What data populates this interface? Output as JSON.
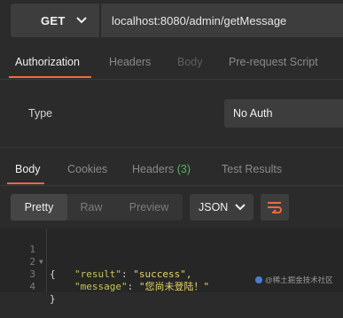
{
  "request": {
    "method": "GET",
    "url": "localhost:8080/admin/getMessage"
  },
  "request_tabs": [
    {
      "label": "Authorization",
      "active": true
    },
    {
      "label": "Headers",
      "active": false
    },
    {
      "label": "Body",
      "active": false
    },
    {
      "label": "Pre-request Script",
      "active": false
    }
  ],
  "auth": {
    "type_label": "Type",
    "type_value": "No Auth"
  },
  "response_tabs": [
    {
      "label": "Body",
      "active": true
    },
    {
      "label": "Cookies",
      "active": false
    },
    {
      "label": "Headers",
      "count": "(3)",
      "active": false
    },
    {
      "label": "Test Results",
      "active": false
    }
  ],
  "format_buttons": [
    {
      "label": "Pretty",
      "active": true
    },
    {
      "label": "Raw",
      "active": false
    },
    {
      "label": "Preview",
      "active": false
    }
  ],
  "format_select": "JSON",
  "code_lines": [
    {
      "num": "1",
      "text": "{"
    },
    {
      "num": "2",
      "key": "\"result\"",
      "value": "\"success\","
    },
    {
      "num": "3",
      "key": "\"message\"",
      "value": "\"您尚未登陆！\""
    },
    {
      "num": "4",
      "text": "}"
    }
  ],
  "watermark": "@稀土掘金技术社区",
  "colors": {
    "accent": "#f26b3a",
    "count": "#58b35a"
  }
}
